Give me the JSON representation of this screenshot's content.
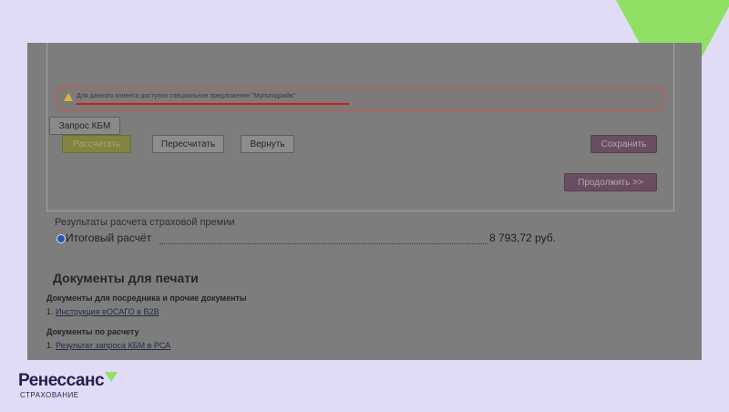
{
  "alert": {
    "text": "Для данного клиента доступно специальное предложение \"Мультидрайв\""
  },
  "buttons": {
    "kbm": "Запрос КБМ",
    "calculate": "Рассчитать",
    "recalculate": "Пересчитать",
    "back": "Вернуть",
    "save": "Сохранить",
    "continue": "Продолжить >>"
  },
  "results": {
    "title": "Результаты расчета страховой премии",
    "total_label": "Итоговый расчёт",
    "total_amount": "8 793,72 руб."
  },
  "documents": {
    "title": "Документы для печати",
    "groups": [
      {
        "heading": "Документы для посредника и прочие документы",
        "items": [
          {
            "num": "1.",
            "label": "Инструкция еОСАГО в B2B"
          }
        ]
      },
      {
        "heading": "Документы по расчету",
        "items": [
          {
            "num": "1.",
            "label": "Результат запроса КБМ в РСА"
          }
        ]
      }
    ]
  },
  "brand": {
    "name": "Ренессанс",
    "subtitle": "СТРАХОВАНИЕ",
    "accent_color": "#8fe064",
    "text_color": "#2a1e50"
  }
}
